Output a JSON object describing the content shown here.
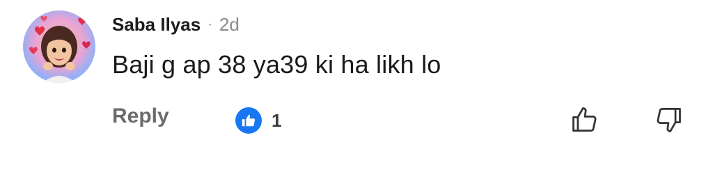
{
  "comment": {
    "author": "Saba Ilyas",
    "separator": "·",
    "timestamp": "2d",
    "text": "Baji g ap 38 ya39 ki ha likh lo",
    "reply_label": "Reply",
    "reaction": {
      "icon": "thumbs-up-badge-icon",
      "count": "1",
      "color": "#1877f2"
    },
    "actions": {
      "upvote_icon": "thumbs-up-outline-icon",
      "downvote_icon": "thumbs-down-outline-icon"
    }
  }
}
